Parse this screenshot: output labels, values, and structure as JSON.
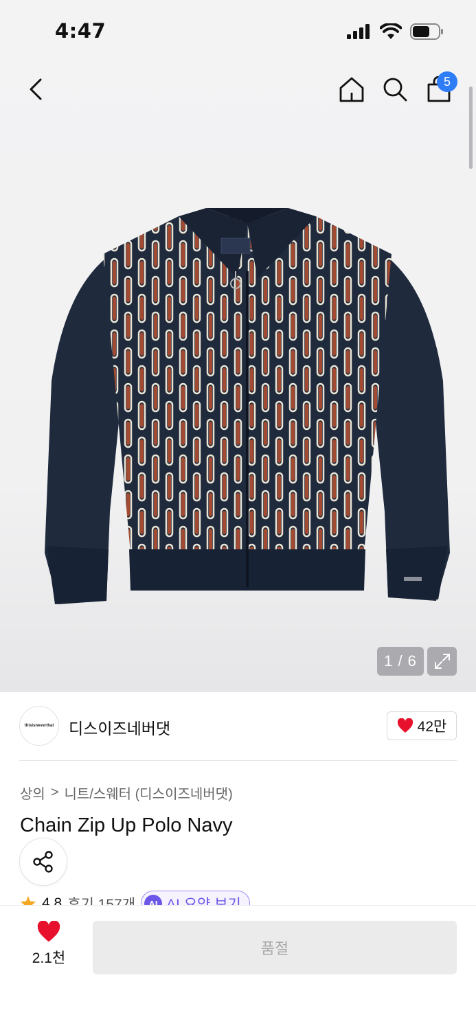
{
  "status_bar": {
    "time": "4:47",
    "icons": [
      "signal-icon",
      "wifi-icon",
      "battery-icon"
    ]
  },
  "nav": {
    "back_icon": "chevron-left-icon",
    "home_icon": "home-icon",
    "search_icon": "search-icon",
    "cart_icon": "cart-icon",
    "cart_badge": "5"
  },
  "gallery": {
    "counter": "1 / 6",
    "expand_icon": "expand-icon"
  },
  "brand": {
    "logo_text": "thisisneverthat",
    "name": "디스이즈네버댓",
    "likes": "42만",
    "like_icon": "heart-icon"
  },
  "breadcrumb": {
    "level1": "상의",
    "separator": ">",
    "level2": "니트/스웨터 (디스이즈네버댓)"
  },
  "product": {
    "title": "Chain Zip Up Polo Navy",
    "rating": "4.8",
    "reviews": "후기 157개",
    "ai_badge": "AI",
    "ai_label": "AI 요약 보기"
  },
  "bottom_bar": {
    "wish_count": "2.1천",
    "buy_button": "품절"
  },
  "colors": {
    "accent_blue": "#2e7cf6",
    "heart_red": "#e8112d",
    "ai_purple": "#6b57e8",
    "sweater_navy": "#1f2a3d",
    "stripe_rust": "#a34a32",
    "stripe_cream": "#e9e4d4"
  }
}
